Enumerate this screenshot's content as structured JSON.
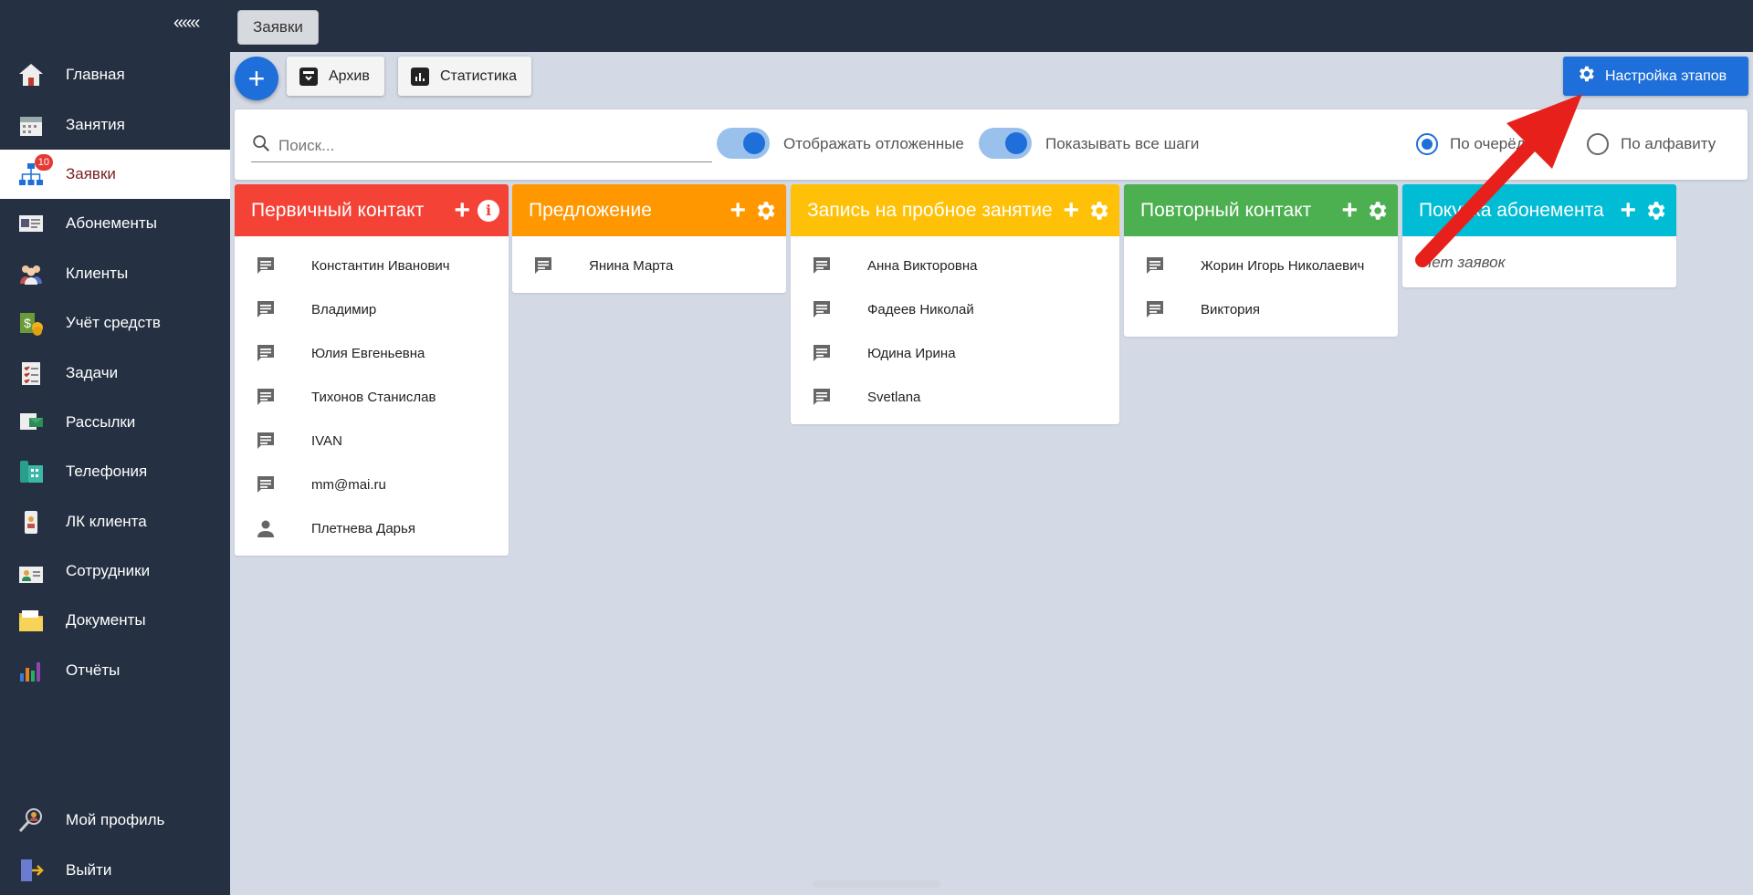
{
  "sidebar": {
    "collapse_label": "«««",
    "items": [
      {
        "label": "Главная",
        "icon": "home-icon"
      },
      {
        "label": "Занятия",
        "icon": "calendar-icon"
      },
      {
        "label": "Заявки",
        "icon": "hierarchy-icon",
        "badge": "10",
        "active": true
      },
      {
        "label": "Абонементы",
        "icon": "card-icon"
      },
      {
        "label": "Клиенты",
        "icon": "people-icon"
      },
      {
        "label": "Учёт средств",
        "icon": "money-icon"
      },
      {
        "label": "Задачи",
        "icon": "checklist-icon"
      },
      {
        "label": "Рассылки",
        "icon": "mailing-icon"
      },
      {
        "label": "Телефония",
        "icon": "phone-icon"
      },
      {
        "label": "ЛК клиента",
        "icon": "badge-icon"
      },
      {
        "label": "Сотрудники",
        "icon": "staff-icon"
      },
      {
        "label": "Документы",
        "icon": "folder-icon"
      },
      {
        "label": "Отчёты",
        "icon": "bar-chart-icon"
      }
    ],
    "bottom": [
      {
        "label": "Мой профиль",
        "icon": "profile-search-icon"
      },
      {
        "label": "Выйти",
        "icon": "logout-door-icon"
      }
    ]
  },
  "topbar": {
    "tab_label": "Заявки"
  },
  "toolbar": {
    "add_label": "+",
    "archive_label": "Архив",
    "stats_label": "Статистика",
    "settings_label": "Настройка этапов"
  },
  "filters": {
    "search_placeholder": "Поиск...",
    "toggle1_label": "Отображать отложенные",
    "toggle2_label": "Показывать все шаги",
    "radio1_label": "По очерёдности",
    "radio2_label": "По алфавиту"
  },
  "columns": [
    {
      "title": "Первичный контакт",
      "color": "#f44336",
      "action": "info",
      "leads": [
        "Константин Иванович",
        "Владимир",
        "Юлия Евгеньевна",
        "Тихонов Станислав",
        "IVAN",
        "mm@mai.ru",
        "Плетнева Дарья"
      ]
    },
    {
      "title": "Предложение",
      "color": "#ff9800",
      "action": "gear",
      "leads": [
        "Янина Марта"
      ]
    },
    {
      "title": "Запись на пробное занятие",
      "color": "#ffc107",
      "action": "gear",
      "leads": [
        "Анна Викторовна",
        "Фадеев Николай",
        "Юдина Ирина",
        "Svetlana"
      ]
    },
    {
      "title": "Повторный контакт",
      "color": "#4caf50",
      "action": "gear",
      "leads": [
        "Жорин Игорь Николаевич",
        "Виктория"
      ]
    },
    {
      "title": "Покупка абонемента",
      "color": "#00bcd4",
      "action": "gear",
      "leads": [],
      "empty_label": "Нет заявок"
    }
  ],
  "colors": {
    "sidebar_bg": "#253142",
    "accent": "#1e6fd9",
    "page_bg": "#d4dae5",
    "arrow": "#e8201c"
  }
}
